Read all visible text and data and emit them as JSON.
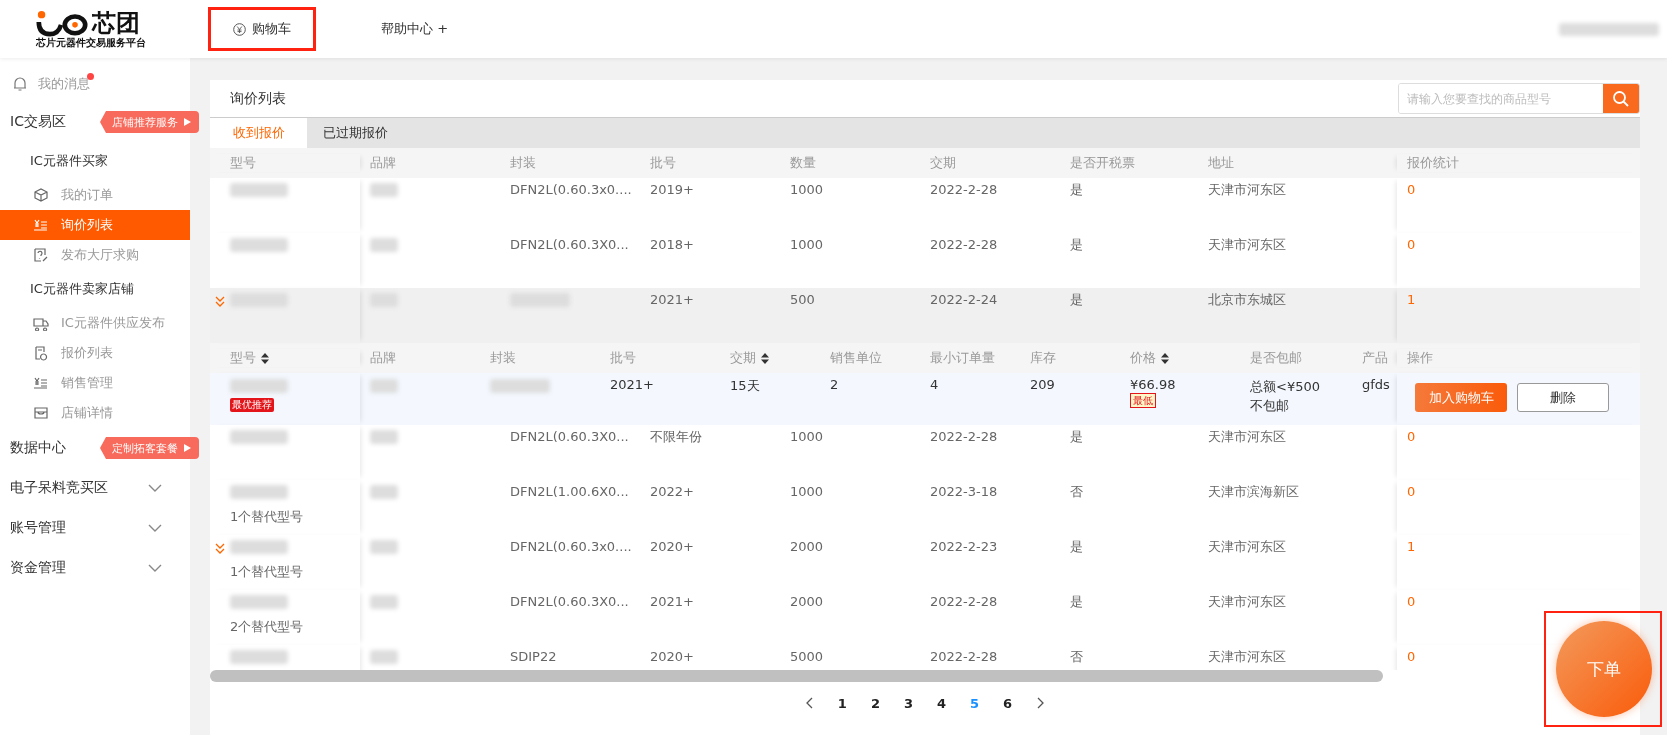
{
  "header": {
    "logo": {
      "name": "芯团",
      "tagline": "芯片元器件交易服务平台"
    },
    "nav": [
      {
        "label": "购物车",
        "annotated": true
      },
      {
        "label": "帮助中心",
        "suffix": "+",
        "annotated": false
      }
    ]
  },
  "sidebar": {
    "messages": {
      "label": "我的消息",
      "unread": true
    },
    "sections": [
      {
        "label": "IC交易区",
        "promo": "店铺推荐服务",
        "groups": [
          {
            "label": "IC元器件买家",
            "items": [
              {
                "label": "我的订单",
                "selected": false
              },
              {
                "label": "询价列表",
                "selected": true
              },
              {
                "label": "发布大厅求购",
                "selected": false
              }
            ]
          },
          {
            "label": "IC元器件卖家店铺",
            "items": [
              {
                "label": "IC元器件供应发布",
                "selected": false
              },
              {
                "label": "报价列表",
                "selected": false
              },
              {
                "label": "销售管理",
                "selected": false
              },
              {
                "label": "店铺详情",
                "selected": false
              }
            ]
          }
        ]
      },
      {
        "label": "数据中心",
        "promo": "定制拓客套餐"
      },
      {
        "label": "电子呆料竞买区",
        "expanded": false
      },
      {
        "label": "账号管理",
        "expanded": false
      },
      {
        "label": "资金管理",
        "expanded": false
      }
    ]
  },
  "main": {
    "title": "询价列表",
    "search": {
      "placeholder": "请输入您要查找的商品型号"
    },
    "tabs": [
      {
        "label": "收到报价",
        "selected": true
      },
      {
        "label": "已过期报价",
        "selected": false
      }
    ],
    "table": {
      "columns": [
        "型号",
        "品牌",
        "封装",
        "批号",
        "数量",
        "交期",
        "是否开税票",
        "地址",
        "报价统计"
      ],
      "rows": [
        {
          "package": "DFN2L(0.60.3x0....",
          "batch": "2019+",
          "quantity": "1000",
          "delivery": "2022-2-28",
          "invoice": "是",
          "address": "天津市河东区",
          "quote_count": "0",
          "flagged": false,
          "expanded": false
        },
        {
          "package": "DFN2L(0.60.3X0...",
          "batch": "2018+",
          "quantity": "1000",
          "delivery": "2022-2-28",
          "invoice": "是",
          "address": "天津市河东区",
          "quote_count": "0",
          "flagged": false,
          "expanded": false
        },
        {
          "batch": "2021+",
          "quantity": "500",
          "delivery": "2022-2-24",
          "invoice": "是",
          "address": "北京市东城区",
          "quote_count": "1",
          "flagged": true,
          "expanded": true,
          "quotes": {
            "columns": [
              {
                "label": "型号",
                "sortable": true
              },
              {
                "label": "品牌",
                "sortable": false
              },
              {
                "label": "封装",
                "sortable": false
              },
              {
                "label": "批号",
                "sortable": false
              },
              {
                "label": "交期",
                "sortable": true
              },
              {
                "label": "销售单位",
                "sortable": false
              },
              {
                "label": "最小订单量",
                "sortable": false
              },
              {
                "label": "库存",
                "sortable": false
              },
              {
                "label": "价格",
                "sortable": true
              },
              {
                "label": "是否包邮",
                "sortable": false
              },
              {
                "label": "产品",
                "sortable": false
              },
              {
                "label": "操作",
                "sortable": false
              }
            ],
            "rows": [
              {
                "badge": "最优推荐",
                "batch": "2021+",
                "delivery": "15天",
                "sales_unit": "2",
                "min_order": "4",
                "stock": "209",
                "price": "¥66.98",
                "price_badge": "最低",
                "shipping": "总额<¥500 不包邮",
                "product": "gfds",
                "actions": [
                  {
                    "label": "加入购物车",
                    "kind": "primary"
                  },
                  {
                    "label": "删除",
                    "kind": "secondary"
                  }
                ]
              }
            ]
          }
        },
        {
          "package": "DFN2L(0.60.3X0...",
          "batch": "不限年份",
          "quantity": "1000",
          "delivery": "2022-2-28",
          "invoice": "是",
          "address": "天津市河东区",
          "quote_count": "0",
          "flagged": false,
          "expanded": false
        },
        {
          "package": "DFN2L(1.00.6X0...",
          "batch": "2022+",
          "quantity": "1000",
          "delivery": "2022-3-18",
          "invoice": "否",
          "address": "天津市滨海新区",
          "quote_count": "0",
          "alternates": "1个替代型号",
          "flagged": false,
          "expanded": false
        },
        {
          "package": "DFN2L(0.60.3x0....",
          "batch": "2020+",
          "quantity": "2000",
          "delivery": "2022-2-23",
          "invoice": "是",
          "address": "天津市河东区",
          "quote_count": "1",
          "alternates": "1个替代型号",
          "flagged": true,
          "expanded": false
        },
        {
          "package": "DFN2L(0.60.3X0...",
          "batch": "2021+",
          "quantity": "2000",
          "delivery": "2022-2-28",
          "invoice": "是",
          "address": "天津市河东区",
          "quote_count": "0",
          "alternates": "2个替代型号",
          "flagged": false,
          "expanded": false
        },
        {
          "package": "SDIP22",
          "batch": "2020+",
          "quantity": "5000",
          "delivery": "2022-2-28",
          "invoice": "否",
          "address": "天津市河东区",
          "quote_count": "0",
          "flagged": false,
          "expanded": false
        }
      ]
    },
    "pagination": {
      "pages": [
        {
          "label": "1",
          "selected": false
        },
        {
          "label": "2",
          "selected": false
        },
        {
          "label": "3",
          "selected": false
        },
        {
          "label": "4",
          "selected": false
        },
        {
          "label": "5",
          "selected": true
        },
        {
          "label": "6",
          "selected": false
        }
      ]
    },
    "order_button": {
      "label": "下单",
      "annotated": true
    }
  }
}
